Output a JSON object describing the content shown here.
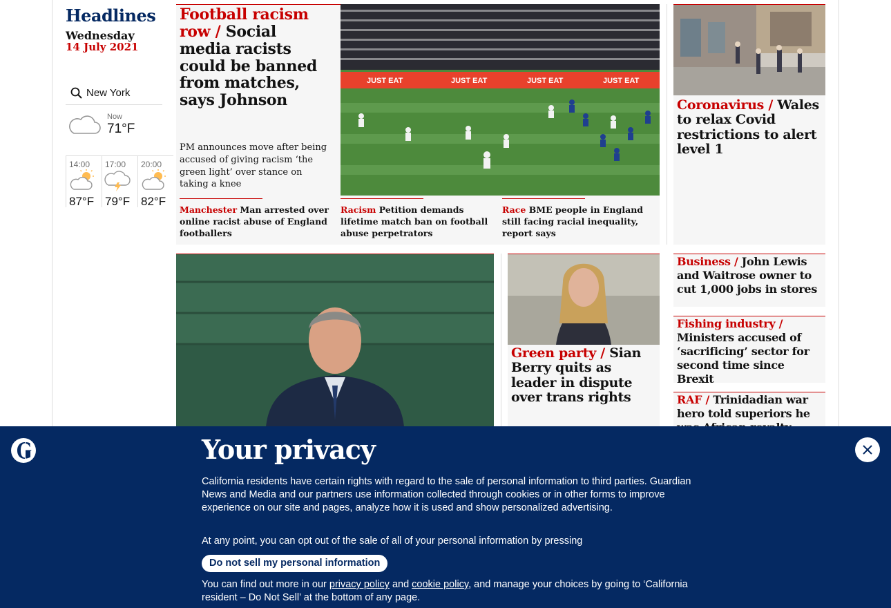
{
  "section": {
    "title": "Headlines",
    "weekday": "Wednesday",
    "date": "14 July 2021"
  },
  "weather": {
    "location": "New York",
    "now_label": "Now",
    "now_temp": "71°F",
    "now_icon": "cloud-icon",
    "forecast": [
      {
        "time": "14:00",
        "temp": "87°F",
        "icon": "partly-sunny-icon"
      },
      {
        "time": "17:00",
        "temp": "79°F",
        "icon": "thunderstorm-icon"
      },
      {
        "time": "20:00",
        "temp": "82°F",
        "icon": "partly-sunny-icon"
      }
    ]
  },
  "lead": {
    "kicker": "Football racism row /",
    "headline": "Social media racists could be banned from matches, says Johnson",
    "standfirst": "PM announces move after being accused of giving racism ‘the green light’ over stance on taking a knee",
    "sublinks": [
      {
        "kicker": "Manchester",
        "text": "Man arrested over online racist abuse of England footballers"
      },
      {
        "kicker": "Racism",
        "text": "Petition demands lifetime match ban on football abuse perpetrators"
      },
      {
        "kicker": "Race",
        "text": "BME people in England still facing racial inequality, report says"
      }
    ]
  },
  "covid": {
    "kicker": "Coronavirus /",
    "headline": "Wales to relax Covid restrictions to alert level 1"
  },
  "green": {
    "kicker": "Green party /",
    "headline": "Sian Berry quits as leader in dispute over trans rights"
  },
  "business": {
    "kicker": "Business /",
    "headline": "John Lewis and Waitrose owner to cut 1,000 jobs in stores"
  },
  "fishing": {
    "kicker": "Fishing industry /",
    "headline": "Ministers accused of ‘sacrificing’ sector for second time since Brexit"
  },
  "raf": {
    "kicker": "RAF /",
    "headline": "Trinidadian war hero told superiors he was African royalty"
  },
  "privacy": {
    "title": "Your privacy",
    "para1": "California residents have certain rights with regard to the sale of personal information to third parties. Guardian News and Media and our partners use information collected through cookies or in other forms to improve experience on our site and pages, analyze how it is used and show personalized advertising.",
    "para2": "At any point, you can opt out of the sale of all of your personal information by pressing",
    "button": "Do not sell my personal information",
    "para3_a": "You can find out more in our",
    "link_privacy": "privacy policy",
    "para3_b": "and",
    "link_cookie": "cookie policy",
    "para3_c": ", and manage your choices by going to ‘California resident – Do Not Sell’ at the bottom of any page."
  },
  "colors": {
    "brand": "#052962",
    "news": "#c70000",
    "card_bg": "#f6f6f6"
  }
}
